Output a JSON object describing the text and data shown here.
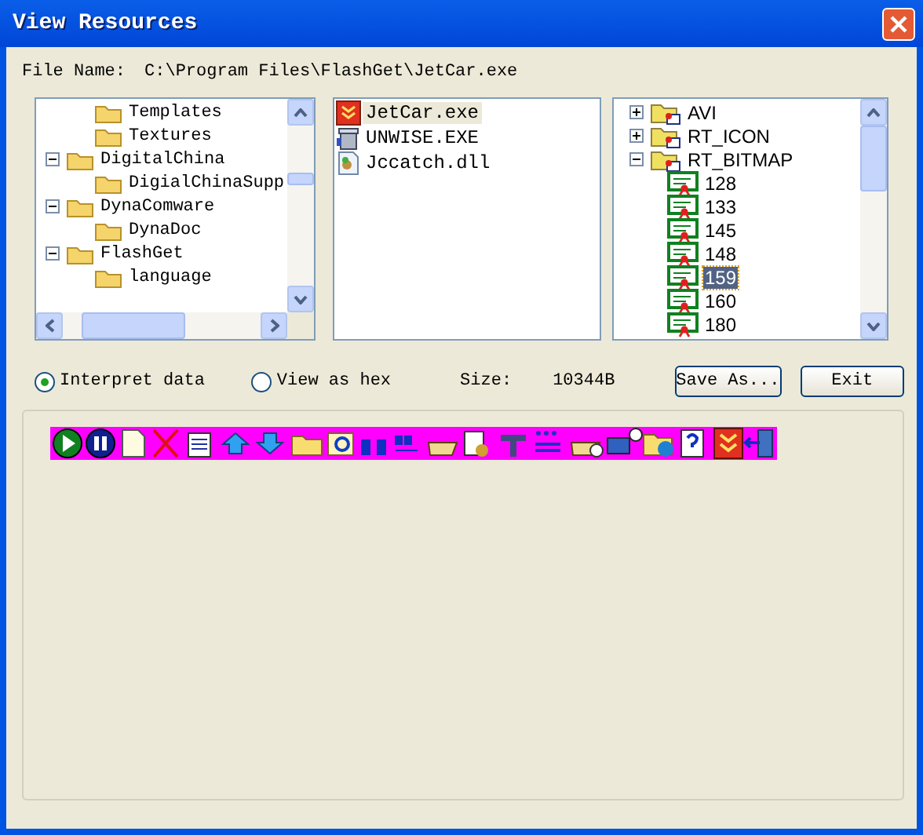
{
  "window": {
    "title": "View Resources"
  },
  "file_name": {
    "label": "File Name:",
    "value": "C:\\Program Files\\FlashGet\\JetCar.exe"
  },
  "folder_tree": {
    "orphan_children": [
      {
        "label": "Templates"
      },
      {
        "label": "Textures"
      }
    ],
    "items": [
      {
        "label": "DigitalChina",
        "expanded": true,
        "children": [
          {
            "label": "DigialChinaSupp"
          }
        ]
      },
      {
        "label": "DynaComware",
        "expanded": true,
        "children": [
          {
            "label": "DynaDoc"
          }
        ]
      },
      {
        "label": "FlashGet",
        "expanded": true,
        "children": [
          {
            "label": "language"
          }
        ]
      }
    ]
  },
  "files": [
    {
      "name": "JetCar.exe",
      "selected": true
    },
    {
      "name": "UNWISE.EXE",
      "selected": false
    },
    {
      "name": "Jccatch.dll",
      "selected": false
    }
  ],
  "resource_tree": [
    {
      "label": "AVI",
      "expanded": false
    },
    {
      "label": "RT_ICON",
      "expanded": false
    },
    {
      "label": "RT_BITMAP",
      "expanded": true,
      "children": [
        {
          "label": "128",
          "selected": false
        },
        {
          "label": "133",
          "selected": false
        },
        {
          "label": "145",
          "selected": false
        },
        {
          "label": "148",
          "selected": false
        },
        {
          "label": "159",
          "selected": true
        },
        {
          "label": "160",
          "selected": false
        },
        {
          "label": "180",
          "selected": false
        }
      ]
    }
  ],
  "view_options": [
    {
      "label": "Interpret data",
      "selected": true
    },
    {
      "label": "View as hex",
      "selected": false
    }
  ],
  "size": {
    "label": "Size:",
    "value": "10344B"
  },
  "buttons": [
    "Save As...",
    "Exit"
  ]
}
